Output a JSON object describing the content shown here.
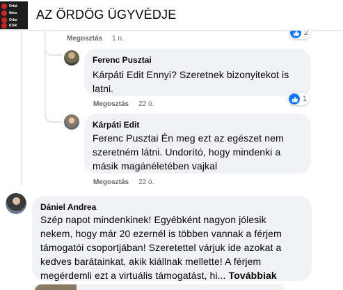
{
  "header": {
    "group_name": "AZ ÖRDÖG ÜGYVÉDJE",
    "thumbnail_lines": [
      "Orbá",
      "fides",
      "Orba",
      "KOR"
    ]
  },
  "prev_comment": {
    "share_label": "Megosztás",
    "time": "1 n.",
    "reaction_count": "2"
  },
  "replies": [
    {
      "author": "Ferenc Pusztai",
      "text_lines": [
        "Kárpáti Edit Ennyi? Szeretnek bizonyitekot is",
        "latni."
      ],
      "share_label": "Megosztás",
      "time": "22 ó.",
      "reaction_count": "1"
    },
    {
      "author": "Kárpáti Edit",
      "text_lines": [
        "Ferenc Pusztai Én meg ezt az egészet nem",
        "szeretném látni. Undorító, hogy mindenki a",
        "másik magánéletében vajkal"
      ],
      "share_label": "Megosztás",
      "time": "22 ó."
    }
  ],
  "comment": {
    "author": "Dániel Andrea",
    "text_lines": [
      "Szép napot mindenkinek! Egyébként nagyon jólesik",
      "nekem, hogy már 20 ezernél is többen vannak a férjem",
      "támogatói csoportjában! Szeretettel várjuk ide azokat a",
      "kedves barátainkat, akik kiállnak mellette! A férjem",
      "megérdemli ezt a virtuális támogatást, hi..."
    ],
    "see_more": "Továbbiak"
  },
  "colors": {
    "bubble": "#f0f2f5",
    "meta_text": "#65676b",
    "like_blue": "#1877f2",
    "thread_line": "#e4e6eb"
  }
}
